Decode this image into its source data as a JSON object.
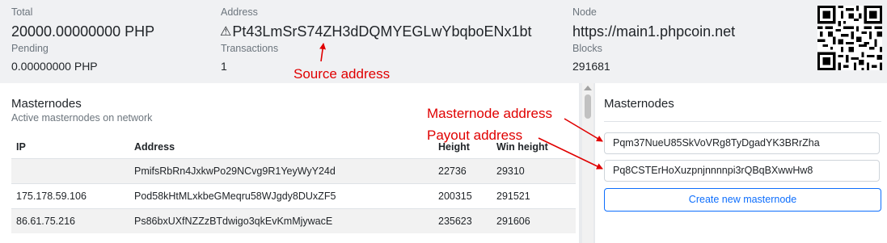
{
  "header": {
    "total_label": "Total",
    "total_value": "20000.00000000 PHP",
    "pending_label": "Pending",
    "pending_value": "0.00000000 PHP",
    "address_label": "Address",
    "address_icon": "warning-triangle-icon",
    "address_value": "Pt43LmSrS74ZH3dDQMYEGLwYbqboENx1bt",
    "transactions_label": "Transactions",
    "transactions_value": "1",
    "node_label": "Node",
    "node_value": "https://main1.phpcoin.net",
    "blocks_label": "Blocks",
    "blocks_value": "291681"
  },
  "masternodes_list": {
    "title": "Masternodes",
    "subtitle": "Active masternodes on network",
    "columns": [
      "IP",
      "Address",
      "Height",
      "Win height"
    ],
    "rows": [
      {
        "ip": "",
        "address": "PmifsRbRn4JxkwPo29NCvg9R1YeyWyY24d",
        "height": "22736",
        "win_height": "29310"
      },
      {
        "ip": "175.178.59.106",
        "address": "Pod58kHtMLxkbeGMeqru58WJgdy8DUxZF5",
        "height": "200315",
        "win_height": "291521"
      },
      {
        "ip": "86.61.75.216",
        "address": "Ps86bxUXfNZZzBTdwigo3qkEvKmMjywacE",
        "height": "235623",
        "win_height": "291606"
      }
    ]
  },
  "masternode_form": {
    "title": "Masternodes",
    "masternode_address_value": "Pqm37NueU85SkVoVRg8TyDgadYK3BRrZha",
    "payout_address_value": "Pq8CSTErHoXuzpnjnnnnpi3rQBqBXwwHw8",
    "create_button_label": "Create new masternode"
  },
  "annotations": {
    "source_address": "Source address",
    "masternode_address": "Masternode address",
    "payout_address": "Payout address"
  },
  "colors": {
    "annotation": "#e00000",
    "button_accent": "#0d6efd",
    "header_background": "#f0f1f3"
  }
}
